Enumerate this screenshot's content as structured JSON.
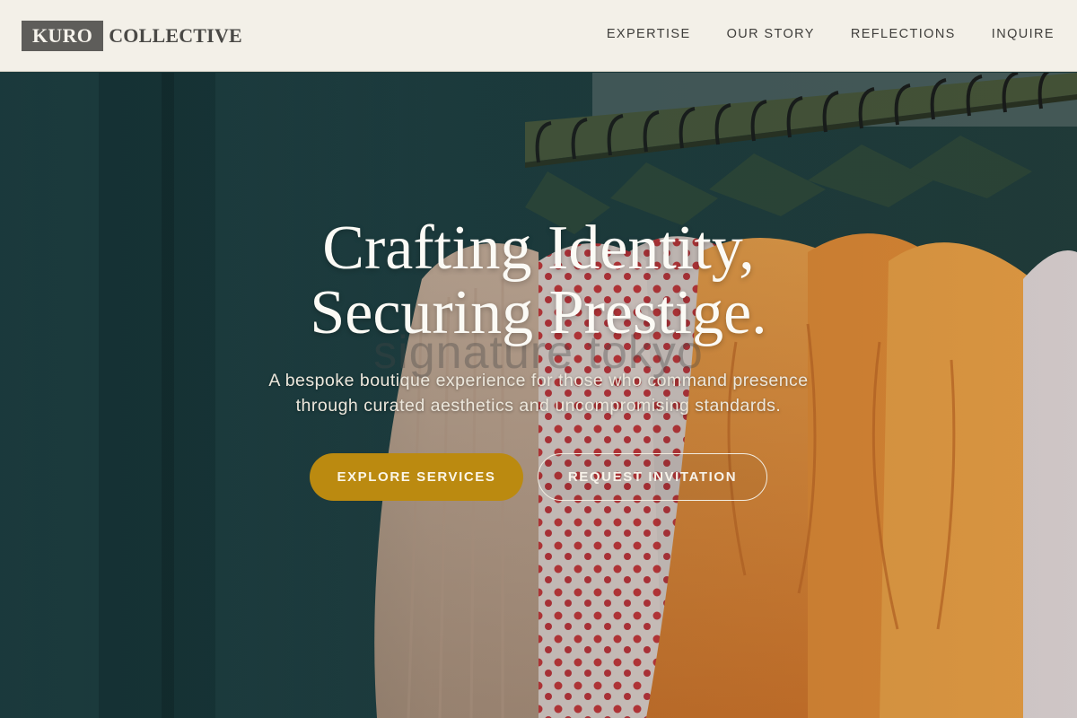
{
  "header": {
    "logo_mark": "KURO",
    "logo_text": "COLLECTIVE",
    "nav": [
      "EXPERTISE",
      "OUR STORY",
      "REFLECTIONS",
      "INQUIRE"
    ]
  },
  "hero": {
    "headline_line1": "Crafting Identity,",
    "headline_line2": "Securing Prestige.",
    "background_word": "signature tokyo",
    "subtitle_line1": "A bespoke boutique experience for those who command presence",
    "subtitle_line2": "through curated aesthetics and uncompromising standards.",
    "primary_cta": "EXPLORE SERVICES",
    "secondary_cta": "REQUEST INVITATION"
  },
  "colors": {
    "header_bg": "#f3f0e8",
    "logo_box": "#5e5d5a",
    "accent_gold": "#bb8a10",
    "wall_teal": "#1d3a3c"
  }
}
